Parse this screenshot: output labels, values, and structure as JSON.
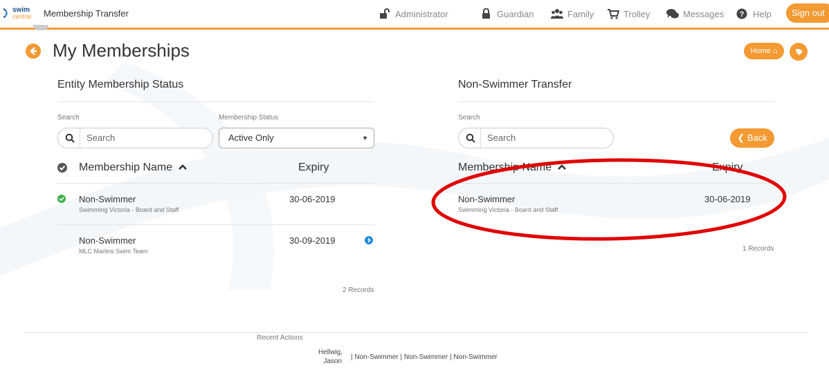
{
  "header": {
    "logo_word1": "swim",
    "logo_word2": "central",
    "app_title": "Membership Transfer",
    "nav": [
      {
        "label": "Administrator",
        "icon": "unlock-icon"
      },
      {
        "label": "Guardian",
        "icon": "lock-icon"
      },
      {
        "label": "Family",
        "icon": "users-icon"
      },
      {
        "label": "Trolley",
        "icon": "cart-icon"
      },
      {
        "label": "Messages",
        "icon": "comments-icon"
      },
      {
        "label": "Help",
        "icon": "question-icon"
      }
    ],
    "sign_out": "Sign out"
  },
  "page": {
    "title": "My Memberships",
    "home_label": "Home",
    "accent": "#f39a32"
  },
  "left": {
    "title": "Entity Membership Status",
    "search_label": "Search",
    "search_placeholder": "Search",
    "status_label": "Membership Status",
    "status_value": "Active Only",
    "col_name": "Membership Name",
    "col_expiry": "Expiry",
    "rows": [
      {
        "name": "Non-Swimmer",
        "org": "Swimming Victoria - Board and Staff",
        "expiry": "30-06-2019",
        "status": "active"
      },
      {
        "name": "Non-Swimmer",
        "org": "MLC Marlins Swim Team",
        "expiry": "30-09-2019",
        "status": "transferable"
      }
    ],
    "records": "2 Records"
  },
  "right": {
    "title": "Non-Swimmer Transfer",
    "search_label": "Search",
    "search_placeholder": "Search",
    "back_label": "Back",
    "col_name": "Membership Name",
    "col_expiry": "Expiry",
    "rows": [
      {
        "name": "Non-Swimmer",
        "org": "Swimming Victoria - Board and Staff",
        "expiry": "30-06-2019"
      }
    ],
    "records": "1 Records"
  },
  "footer": {
    "recent_label": "Recent Actions",
    "person_first": "Hellwig,",
    "person_last": "Jason",
    "items": [
      "Non-Swimmer",
      "Non-Swimmer",
      "Non-Swimmer"
    ]
  },
  "annotation_color": "#e00000"
}
